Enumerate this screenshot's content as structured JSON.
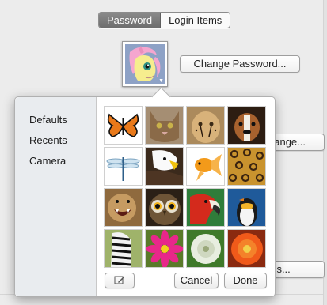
{
  "tabs": [
    {
      "label": "Password",
      "active": true
    },
    {
      "label": "Login Items",
      "active": false
    }
  ],
  "buttons": {
    "change_password": "Change Password...",
    "change2": "hange...",
    "parental_controls": "rols..."
  },
  "picker": {
    "sidebar": [
      "Defaults",
      "Recents",
      "Camera"
    ],
    "selected_sidebar": "Defaults",
    "images": [
      "butterfly",
      "cat",
      "cheetah",
      "dog",
      "dragonfly",
      "eagle",
      "goldfish",
      "leopard",
      "lion",
      "owl",
      "parrot",
      "penguin",
      "zebra",
      "pink-flower",
      "dandelion",
      "red-flower"
    ],
    "cancel_label": "Cancel",
    "done_label": "Done",
    "edit_icon": "pencil-icon"
  },
  "colors": {
    "accent": "#707070"
  }
}
